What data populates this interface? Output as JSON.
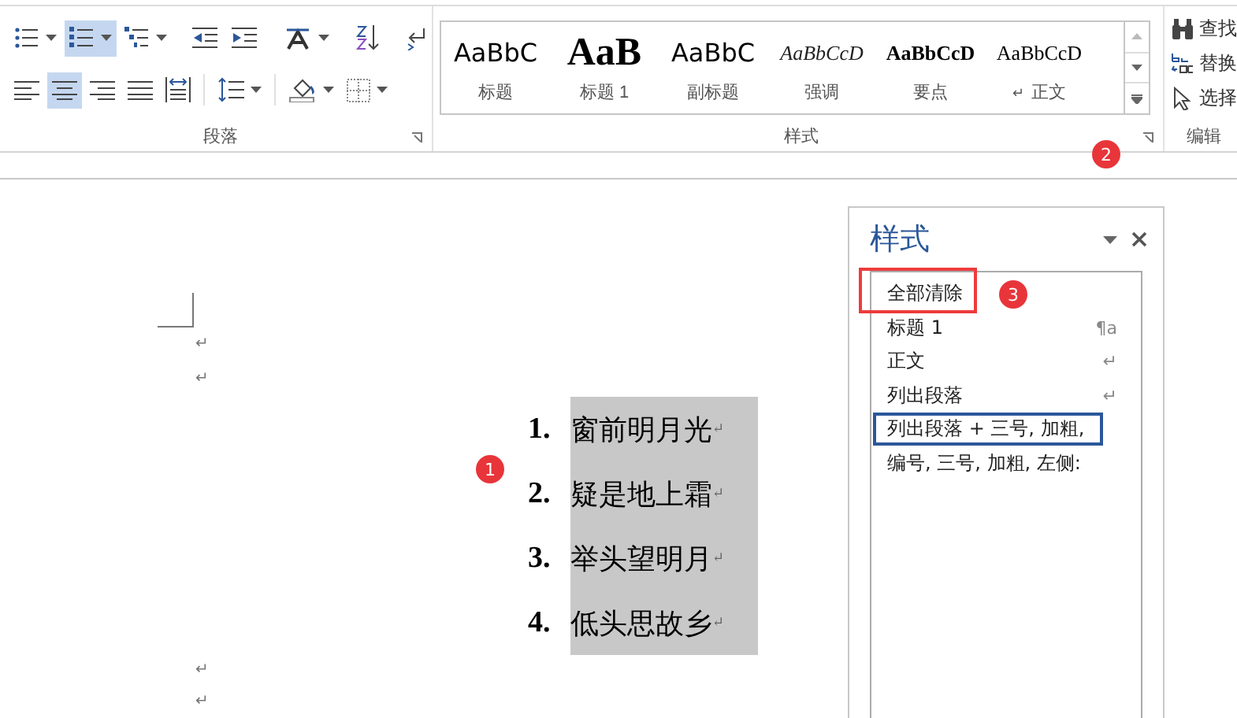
{
  "ribbon": {
    "paragraph": {
      "label": "段落",
      "rows": [
        [
          {
            "kind": "bullets",
            "dropdown": true,
            "selected": false
          },
          {
            "kind": "numbering",
            "dropdown": true,
            "selected": true
          },
          {
            "kind": "multilevel",
            "dropdown": true,
            "selected": false
          },
          {
            "kind": "sep"
          },
          {
            "kind": "outdent",
            "dropdown": false,
            "selected": false
          },
          {
            "kind": "indent",
            "dropdown": false,
            "selected": false
          },
          {
            "kind": "sep"
          },
          {
            "kind": "asian-layout",
            "dropdown": true,
            "selected": false
          },
          {
            "kind": "sep"
          },
          {
            "kind": "sort",
            "dropdown": false,
            "selected": false
          },
          {
            "kind": "sep"
          },
          {
            "kind": "marks",
            "dropdown": false,
            "selected": false
          }
        ],
        [
          {
            "kind": "align-left",
            "dropdown": false,
            "selected": false
          },
          {
            "kind": "align-center",
            "dropdown": false,
            "selected": true
          },
          {
            "kind": "align-right",
            "dropdown": false,
            "selected": false
          },
          {
            "kind": "justify",
            "dropdown": false,
            "selected": false
          },
          {
            "kind": "distribute",
            "dropdown": false,
            "selected": false
          },
          {
            "kind": "sep"
          },
          {
            "kind": "line-spacing",
            "dropdown": true,
            "selected": false
          },
          {
            "kind": "sep"
          },
          {
            "kind": "shading",
            "dropdown": true,
            "selected": false
          },
          {
            "kind": "borders",
            "dropdown": true,
            "selected": false
          }
        ]
      ]
    },
    "styles": {
      "label": "样式",
      "gallery": [
        {
          "sample": "AaBbC",
          "name": "标题",
          "kind": "title"
        },
        {
          "sample": "AaB",
          "name": "标题 1",
          "kind": "heading1"
        },
        {
          "sample": "AaBbC",
          "name": "副标题",
          "kind": "subtitle"
        },
        {
          "sample": "AaBbCcD",
          "name": "强调",
          "kind": "emphasis"
        },
        {
          "sample": "AaBbCcD",
          "name": "要点",
          "kind": "strong"
        },
        {
          "sample": "AaBbCcD",
          "name": "正文",
          "kind": "normal",
          "mark": "↵"
        }
      ]
    },
    "editing": {
      "label": "编辑",
      "items": [
        {
          "label": "查找",
          "kind": "find"
        },
        {
          "label": "替换",
          "kind": "replace"
        },
        {
          "label": "选择",
          "kind": "select"
        }
      ]
    }
  },
  "document": {
    "blank_before": [
      "↵",
      "↵"
    ],
    "list": [
      {
        "number": "1.",
        "text": "窗前明月光",
        "mark": "↵"
      },
      {
        "number": "2.",
        "text": "疑是地上霜",
        "mark": "↵"
      },
      {
        "number": "3.",
        "text": "举头望明月",
        "mark": "↵"
      },
      {
        "number": "4.",
        "text": "低头思故乡",
        "mark": "↵"
      }
    ],
    "blank_after": [
      "↵",
      "↵"
    ]
  },
  "styles_pane": {
    "title": "样式",
    "items": [
      {
        "label": "全部清除",
        "selected": false,
        "highlighted": true,
        "callout": "3"
      },
      {
        "label": "标题 1",
        "selected": false,
        "highlighted": false,
        "mark": "¶a"
      },
      {
        "label": "正文",
        "selected": false,
        "highlighted": false,
        "mark": "↵"
      },
      {
        "label": "列出段落",
        "selected": false,
        "highlighted": false,
        "mark": "↵"
      },
      {
        "label": "列出段落 + 三号, 加粗,",
        "selected": true,
        "highlighted": false
      },
      {
        "label": "编号, 三号, 加粗, 左侧:",
        "selected": false,
        "highlighted": false
      }
    ]
  },
  "callouts": {
    "document": "1",
    "ribbon": "2"
  }
}
